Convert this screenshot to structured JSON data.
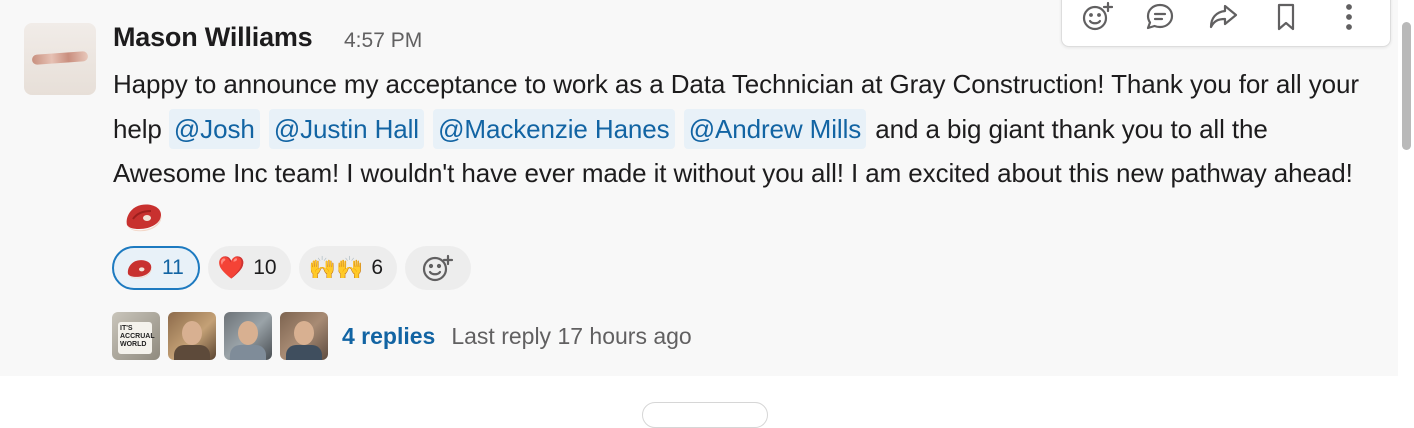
{
  "message": {
    "sender": "Mason Williams",
    "timestamp": "4:57 PM",
    "text_part1": "Happy to announce my acceptance to work as a Data Technician at Gray Construction!  Thank you for all your help ",
    "mentions": [
      "@Josh",
      "@Justin Hall",
      "@Mackenzie Hanes",
      "@Andrew Mills"
    ],
    "text_part2": " and a  big giant thank you to all the Awesome Inc team!  I wouldn't have ever made it without you all!  I am excited about this new pathway ahead!",
    "trailing_emoji": "steak-icon"
  },
  "reactions": [
    {
      "emoji": "steak-icon",
      "count": "11",
      "active": true
    },
    {
      "emoji": "❤️",
      "count": "10",
      "active": false
    },
    {
      "emoji": "🙌🙌",
      "count": "6",
      "active": false
    }
  ],
  "add_reaction_icon": "add-emoji-icon",
  "thread": {
    "reply_avatars": [
      "reply-avatar-1",
      "reply-avatar-2",
      "reply-avatar-3",
      "reply-avatar-4"
    ],
    "mug_text": "IT'S ACCRUAL WORLD",
    "replies_label": "4 replies",
    "last_reply_label": "Last reply 17 hours ago"
  },
  "toolbar": {
    "icons": [
      "add-reaction-icon",
      "reply-in-thread-icon",
      "share-icon",
      "bookmark-icon",
      "more-actions-icon"
    ]
  },
  "colors": {
    "link": "#1264a3",
    "mention_bg": "#e8f1f8",
    "active_reaction_border": "#1d7ac0",
    "message_bg": "#f8f8f8"
  }
}
